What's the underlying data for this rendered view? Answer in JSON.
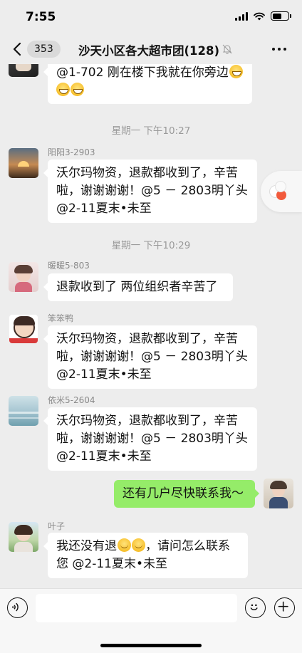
{
  "status_bar": {
    "time": "7:55"
  },
  "header": {
    "back_count": "353",
    "title": "沙天小区各大超市团(128)"
  },
  "messages": [
    {
      "text": "@1-702 刚在楼下我就在你旁边"
    },
    {
      "timestamp": "星期一 下午10:27"
    },
    {
      "sender": "阳阳3-2903",
      "text": "沃尔玛物资，退款都收到了，辛苦啦，谢谢谢谢！@5 － 2803明丫头 @2-11夏末•未至"
    },
    {
      "timestamp": "星期一 下午10:29"
    },
    {
      "sender": "暖暖5-803",
      "text": "退款收到了 两位组织者辛苦了"
    },
    {
      "sender": "笨笨鸭",
      "text": "沃尔玛物资，退款都收到了，辛苦啦，谢谢谢谢！@5 － 2803明丫头 @2-11夏末•未至"
    },
    {
      "sender": "依米5-2604",
      "text": "沃尔玛物资，退款都收到了，辛苦啦，谢谢谢谢！@5 － 2803明丫头 @2-11夏末•未至"
    },
    {
      "text": "还有几户尽快联系我～"
    },
    {
      "sender": "叶子",
      "text_before": "我还没有退",
      "text_after": "，请问怎么联系您 @2-11夏末•未至"
    }
  ],
  "icons": {
    "back": "chevron-left-icon",
    "mute": "bell-off-icon",
    "more": "ellipsis-icon",
    "voice": "voice-icon",
    "emoji": "smiley-icon",
    "plus": "plus-icon"
  },
  "colors": {
    "background": "#ededed",
    "my_bubble": "#95ec69",
    "other_bubble": "#ffffff"
  }
}
